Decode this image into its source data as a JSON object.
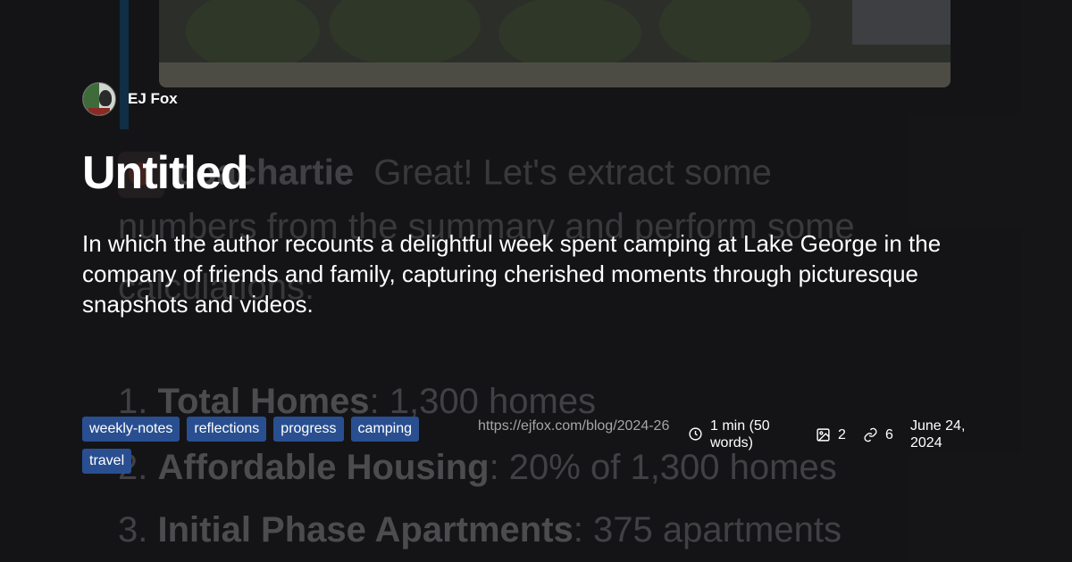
{
  "background": {
    "chat_user": "coachartie",
    "chat_line1": "Great! Let's extract some",
    "chat_line2": "numbers from the summary and perform some",
    "chat_line3": "calculations:",
    "list": [
      {
        "num": "1.",
        "label": "Total Homes",
        "value": ": 1,300 homes"
      },
      {
        "num": "2.",
        "label": "Affordable Housing",
        "value": ": 20% of 1,300 homes"
      },
      {
        "num": "3.",
        "label": "Initial Phase Apartments",
        "value": ": 375 apartments"
      }
    ]
  },
  "author": {
    "name": "EJ Fox"
  },
  "post": {
    "title": "Untitled",
    "description": "In which the author recounts a delightful week spent camping at Lake George in the company of friends and family, capturing cherished moments through picturesque snapshots and videos."
  },
  "tags": [
    "weekly-notes",
    "reflections",
    "progress",
    "camping",
    "travel"
  ],
  "meta": {
    "url": "https://ejfox.com/blog/2024-26",
    "reading_time": "1 min (50 words)",
    "images": "2",
    "links": "6",
    "date": "June 24, 2024",
    "icons": {
      "time": "clock-icon",
      "images": "image-icon",
      "links": "link-icon"
    }
  },
  "colors": {
    "background": "#151517",
    "tag": "#294f91",
    "text": "#ffffff",
    "muted": "#a5a5a8"
  }
}
